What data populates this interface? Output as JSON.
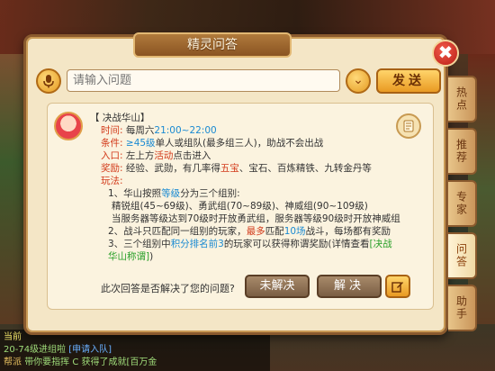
{
  "dialog": {
    "title": "精灵问答",
    "close_label": "✖"
  },
  "search": {
    "placeholder": "请输入问题",
    "send_label": "发送",
    "dropdown_label": "⌄"
  },
  "answer": {
    "heading": "【 决战华山】",
    "time_label": "时间:",
    "time_pre": "每周六",
    "time_value": "21:00~22:00",
    "cond_label": "条件:",
    "cond_level": "≥45级",
    "cond_text": "单人或组队(最多组三人)，助战不会出战",
    "entry_label": "入口:",
    "entry_pre": "左上方",
    "entry_hl": "活动",
    "entry_post": "点击进入",
    "reward_label": "奖励:",
    "reward_pre": "经验、武勋，有几率得",
    "reward_hl": "五宝",
    "reward_post": "、宝石、百炼精铁、九转金丹等",
    "play_label": "玩法:",
    "p1_pre": "1、华山按照",
    "p1_hl": "等级",
    "p1_post": "分为三个组别:",
    "p1_groups": "精锐组(45~69级)、勇武组(70~89级)、神威组(90~109级)",
    "p1_note": "当服务器等级达到70级时开放勇武组，服务器等级90级时开放神威组",
    "p2_pre": "2、战斗只匹配同一组别的玩家，",
    "p2_hl1": "最多",
    "p2_mid1": "匹配",
    "p2_hl2": "10场",
    "p2_post": "战斗，每场都有奖励",
    "p3_pre": "3、三个组别中",
    "p3_hl": "积分排名前3",
    "p3_post": "的玩家可以获得称谓奖励(详情查看",
    "p3_link": "[决战华山称谓]",
    "p3_end": ")"
  },
  "feedback": {
    "question": "此次回答是否解决了您的问题?",
    "unsolved_label": "未解决",
    "solved_label": "解决"
  },
  "side_tabs": [
    {
      "label": "热点",
      "active": false
    },
    {
      "label": "推荐",
      "active": false
    },
    {
      "label": "专家",
      "active": false
    },
    {
      "label": "问答",
      "active": true
    },
    {
      "label": "助手",
      "active": false
    }
  ],
  "chat": {
    "line0": "当前",
    "line1_pre": "20-74级进组啦",
    "line1_link": "[申请入队]",
    "line2_tag": "帮派",
    "line2_text": "带你要指挥 C 获得了成就[百万金"
  },
  "colors": {
    "accent_orange": "#e99a23",
    "highlight_red": "#d23a1a",
    "highlight_blue": "#1a8ad2",
    "highlight_green": "#2aa02a",
    "panel_bg": "#f4e6c6"
  }
}
